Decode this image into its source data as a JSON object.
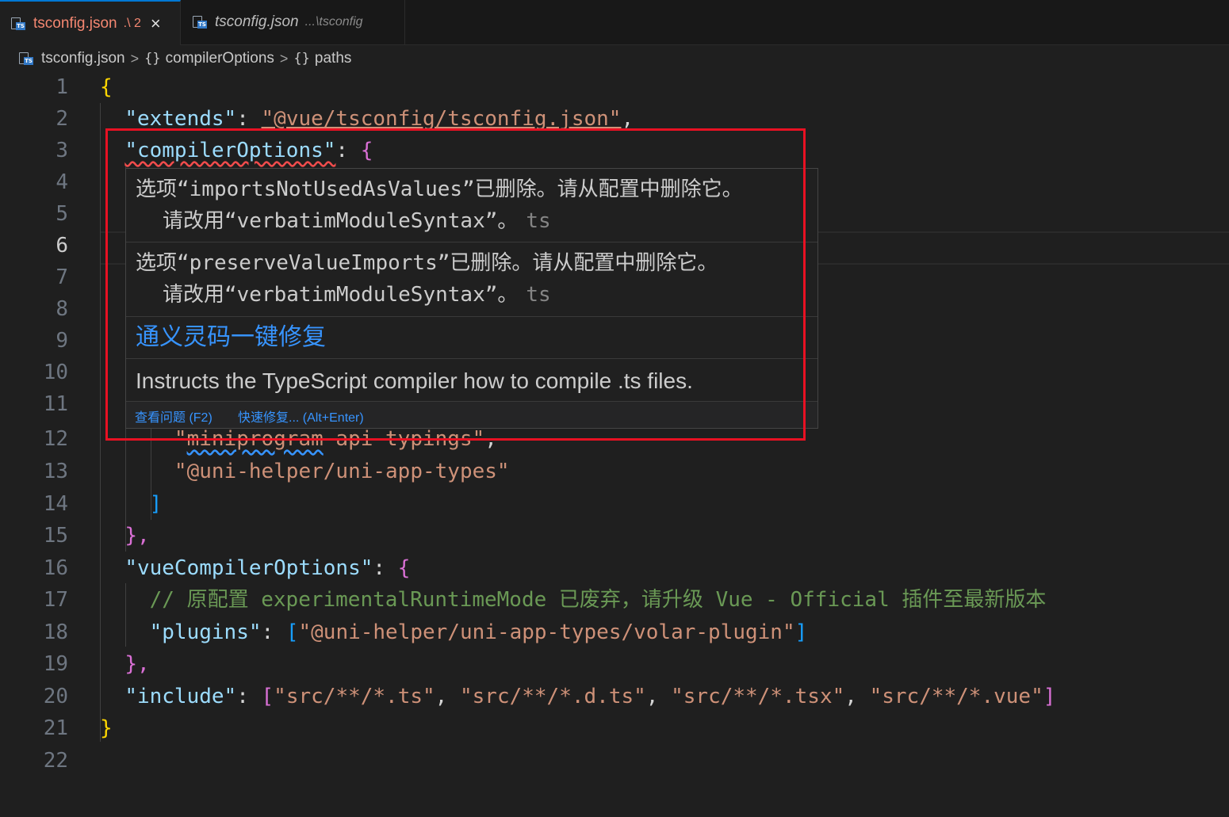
{
  "tabs": [
    {
      "title": "tsconfig.json",
      "path": ".\\ 2",
      "close": "×"
    },
    {
      "title": "tsconfig.json",
      "path": "...\\tsconfig"
    }
  ],
  "breadcrumb": {
    "file": "tsconfig.json",
    "sep": ">",
    "sym": "{}",
    "items": [
      "compilerOptions",
      "paths"
    ]
  },
  "line_numbers": [
    "1",
    "2",
    "3",
    "4",
    "5",
    "6",
    "7",
    "8",
    "9",
    "10",
    "11",
    "12",
    "13",
    "14",
    "15",
    "16",
    "17",
    "18",
    "19",
    "20",
    "21",
    "22"
  ],
  "code": {
    "l1_open": "{",
    "l2_key": "\"extends\"",
    "l2_colon": ": ",
    "l2_value": "\"@vue/tsconfig/tsconfig.json\"",
    "l2_comma": ",",
    "l3_key": "\"compilerOptions\"",
    "l3_colon": ": ",
    "l3_open": "{",
    "l12_q1": "\"",
    "l12_word": "miniprogram",
    "l12_rest": "-api-typings\"",
    "l12_comma": ",",
    "l13_value": "\"@uni-helper/uni-app-types\"",
    "l14_close": "]",
    "l15_close": "},",
    "l16_key": "\"vueCompilerOptions\"",
    "l16_colon": ": ",
    "l16_open": "{",
    "l17_comment": "// 原配置 experimentalRuntimeMode 已废弃，请升级 Vue - Official 插件至最新版本",
    "l18_key": "\"plugins\"",
    "l18_colon": ": ",
    "l18_open": "[",
    "l18_value": "\"@uni-helper/uni-app-types/volar-plugin\"",
    "l18_close": "]",
    "l19_close": "},",
    "l20_key": "\"include\"",
    "l20_colon": ": ",
    "l20_open": "[",
    "l20_v1": "\"src/**/*.ts\"",
    "l20_v2": "\"src/**/*.d.ts\"",
    "l20_v3": "\"src/**/*.tsx\"",
    "l20_v4": "\"src/**/*.vue\"",
    "l20_sep": ", ",
    "l20_close": "]",
    "l21_close": "}"
  },
  "hover": {
    "diag1_line1": "选项“importsNotUsedAsValues”已删除。请从配置中删除它。",
    "diag1_line2": "请改用“verbatimModuleSyntax”。",
    "diag2_line1": "选项“preserveValueImports”已删除。请从配置中删除它。",
    "diag2_line2": "请改用“verbatimModuleSyntax”。",
    "source": "ts",
    "fix_link": "通义灵码一键修复",
    "description": "Instructs the TypeScript compiler how to compile .ts files.",
    "action_view": "查看问题 (F2)",
    "action_fix": "快速修复... (Alt+Enter)"
  },
  "colors": {
    "accent": "#0078d4",
    "error": "#f14c4c",
    "highlight_box": "#e81123",
    "link": "#3794ff"
  }
}
